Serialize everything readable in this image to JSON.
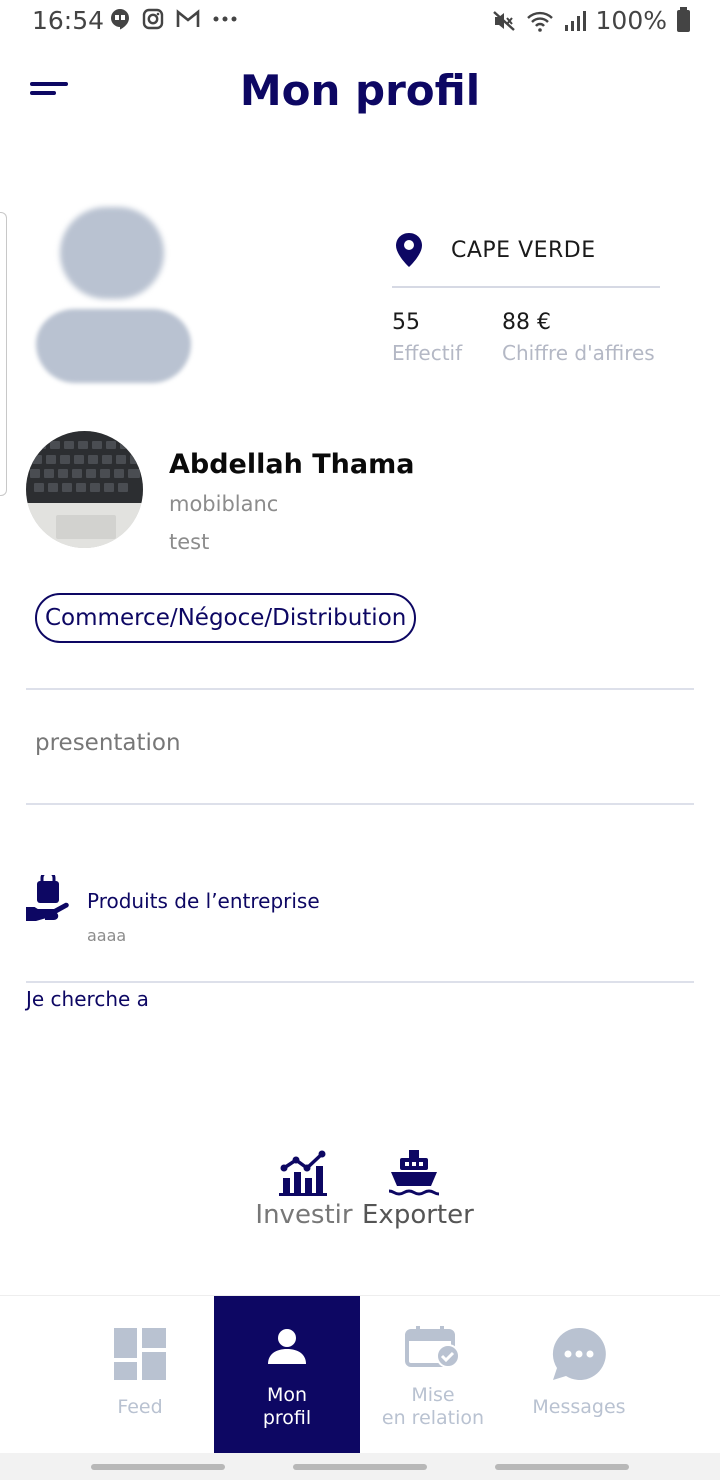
{
  "status_bar": {
    "time": "16:54",
    "battery": "100%",
    "left_icons": [
      "hangouts-icon",
      "instagram-icon",
      "gmail-icon",
      "more-dots-icon"
    ],
    "right_icons": [
      "mute-icon",
      "wifi-icon",
      "signal-icon",
      "battery-icon"
    ]
  },
  "header": {
    "title": "Mon profil"
  },
  "profile": {
    "location": "CAPE VERDE",
    "effectif_value": "55",
    "effectif_label": "Effectif",
    "ca_value": "88 €",
    "ca_label": "Chiffre d'affires",
    "name": "Abdellah Thama",
    "company": "mobiblanc",
    "role": "test",
    "sector": "Commerce/Négoce/Distribution",
    "presentation": "presentation",
    "products_title": "Produits de l’entreprise",
    "products_value": "aaaa",
    "search_title": "Je cherche a"
  },
  "goals": [
    {
      "label": "Investir",
      "icon": "investment-chart-icon"
    },
    {
      "label": "Exporter",
      "icon": "ship-icon"
    }
  ],
  "bottom_nav": {
    "feed": "Feed",
    "profile_line1": "Mon",
    "profile_line2": "profil",
    "relation_line1": "Mise",
    "relation_line2": "en relation",
    "messages": "Messages"
  },
  "colors": {
    "primary": "#0d0763",
    "inactive": "#b9c2d1",
    "muted_text": "#8c8c8c"
  }
}
